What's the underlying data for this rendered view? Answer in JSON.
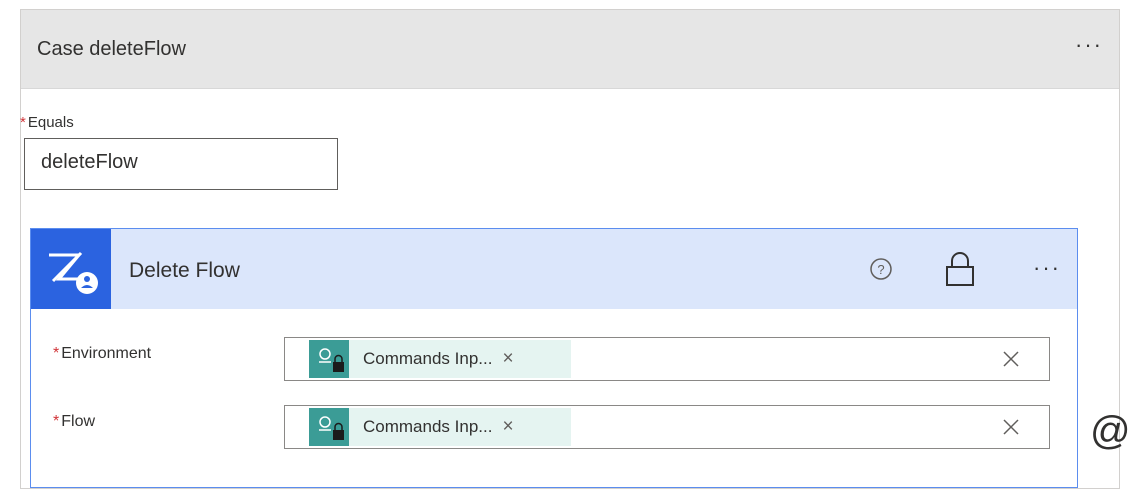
{
  "case": {
    "title": "Case deleteFlow",
    "more": "···",
    "equals": {
      "required": "*",
      "label": "Equals",
      "value": "deleteFlow"
    }
  },
  "action": {
    "title": "Delete Flow",
    "more": "···",
    "icons": [
      "power-automate-management-icon",
      "help-icon",
      "lock-icon"
    ],
    "fields": [
      {
        "required": "*",
        "label": "Environment",
        "token": "Commands Inp...",
        "token_remove": "×"
      },
      {
        "required": "*",
        "label": "Flow",
        "token": "Commands Inp...",
        "token_remove": "×"
      }
    ]
  },
  "floating": {
    "text": "@"
  },
  "colors": {
    "accent": "#2b63e0",
    "header_bg": "#dbe6fb",
    "token_bg": "#e5f4f1",
    "token_icon": "#3b9c96",
    "required": "#d13438"
  }
}
